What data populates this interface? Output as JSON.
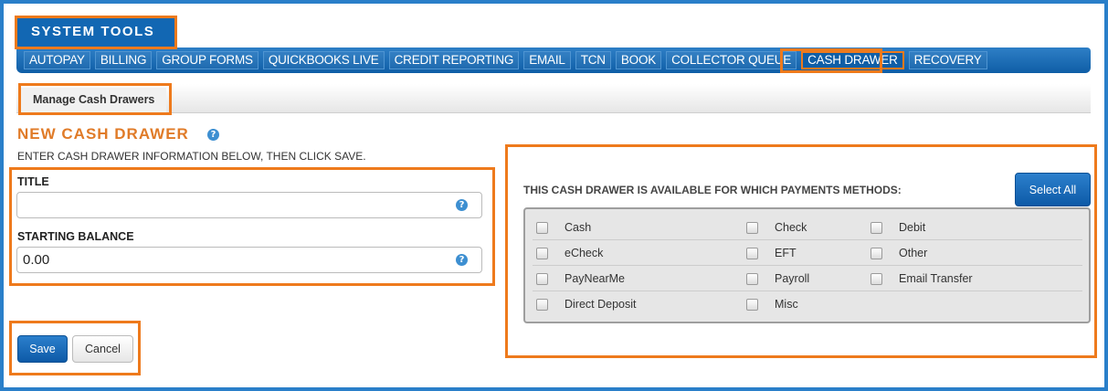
{
  "header": {
    "title": "SYSTEM TOOLS"
  },
  "nav": {
    "items": [
      {
        "label": "AUTOPAY"
      },
      {
        "label": "BILLING"
      },
      {
        "label": "GROUP FORMS"
      },
      {
        "label": "QUICKBOOKS LIVE"
      },
      {
        "label": "CREDIT REPORTING"
      },
      {
        "label": "EMAIL"
      },
      {
        "label": "TCN"
      },
      {
        "label": "BOOK"
      },
      {
        "label": "COLLECTOR QUEUE"
      },
      {
        "label": "CASH DRAWER"
      },
      {
        "label": "RECOVERY"
      }
    ],
    "active": "CASH DRAWER"
  },
  "subnav": {
    "tab_label": "Manage Cash Drawers"
  },
  "page": {
    "title": "NEW CASH DRAWER",
    "instructions": "ENTER CASH DRAWER INFORMATION BELOW, THEN CLICK SAVE.",
    "help_glyph": "?"
  },
  "form": {
    "title_label": "TITLE",
    "title_value": "",
    "balance_label": "STARTING BALANCE",
    "balance_value": "0.00"
  },
  "buttons": {
    "save": "Save",
    "cancel": "Cancel",
    "select_all": "Select All"
  },
  "payment_methods": {
    "label": "THIS CASH DRAWER IS AVAILABLE FOR WHICH PAYMENTS METHODS:",
    "rows": [
      [
        {
          "label": "Cash",
          "checked": false
        },
        {
          "label": "Check",
          "checked": false
        },
        {
          "label": "Debit",
          "checked": false
        }
      ],
      [
        {
          "label": "eCheck",
          "checked": false
        },
        {
          "label": "EFT",
          "checked": false
        },
        {
          "label": "Other",
          "checked": false
        }
      ],
      [
        {
          "label": "PayNearMe",
          "checked": false
        },
        {
          "label": "Payroll",
          "checked": false
        },
        {
          "label": "Email Transfer",
          "checked": false
        }
      ],
      [
        {
          "label": "Direct Deposit",
          "checked": false
        },
        {
          "label": "Misc",
          "checked": false
        }
      ]
    ]
  },
  "colors": {
    "accent_highlight": "#ee7a1c",
    "brand_blue": "#1267b3",
    "title_orange": "#e07b28"
  }
}
